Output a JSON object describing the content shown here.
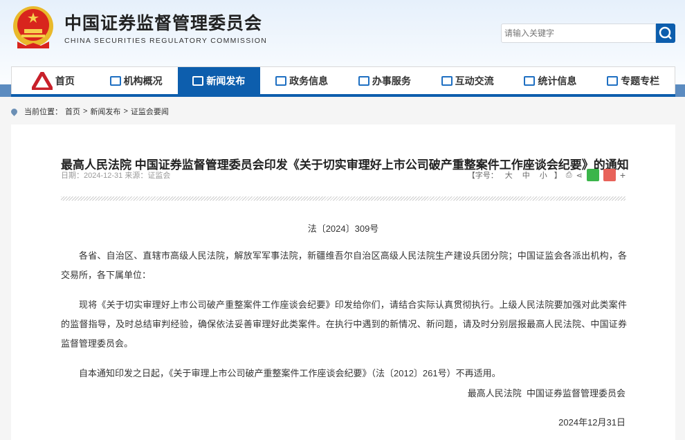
{
  "header": {
    "title_cn": "中国证券监督管理委员会",
    "title_en": "CHINA SECURITIES REGULATORY COMMISSION",
    "search_placeholder": "请输入关键字"
  },
  "nav": [
    {
      "label": "首页",
      "icon": "home-logo-icon"
    },
    {
      "label": "机构概况",
      "icon": "institution-icon"
    },
    {
      "label": "新闻发布",
      "icon": "news-icon"
    },
    {
      "label": "政务信息",
      "icon": "monitor-icon"
    },
    {
      "label": "办事服务",
      "icon": "service-icon"
    },
    {
      "label": "互动交流",
      "icon": "chat-icon"
    },
    {
      "label": "统计信息",
      "icon": "chart-icon"
    },
    {
      "label": "专题专栏",
      "icon": "document-icon"
    }
  ],
  "breadcrumb": {
    "label": "当前位置：",
    "items": [
      "首页",
      ">",
      "新闻发布",
      ">",
      "证监会要闻"
    ]
  },
  "article": {
    "title": "最高人民法院 中国证券监督管理委员会印发《关于切实审理好上市公司破产重整案件工作座谈会纪要》的通知",
    "meta": "日期：2024-12-31 来源：证监会",
    "font_label": "【字号：",
    "font_sizes": [
      "大",
      "中",
      "小"
    ],
    "font_close": "】",
    "plus": "+",
    "doc_number": "法〔2024〕309号",
    "paragraphs": [
      "各省、自治区、直辖市高级人民法院，解放军军事法院，新疆维吾尔自治区高级人民法院生产建设兵团分院；中国证监会各派出机构，各交易所，各下属单位：",
      "现将《关于切实审理好上市公司破产重整案件工作座谈会纪要》印发给你们，请结合实际认真贯彻执行。上级人民法院要加强对此类案件的监督指导，及时总结审判经验，确保依法妥善审理好此类案件。在执行中遇到的新情况、新问题，请及时分别层报最高人民法院、中国证券监督管理委员会。",
      "自本通知印发之日起，《关于审理上市公司破产重整案件工作座谈会纪要》（法〔2012〕261号）不再适用。"
    ],
    "signature": "最高人民法院  中国证券监督管理委员会",
    "date": "2024年12月31日"
  },
  "colors": {
    "brand": "#0d5ead",
    "wechat": "#3bb54a",
    "weibo": "#e8625a"
  }
}
